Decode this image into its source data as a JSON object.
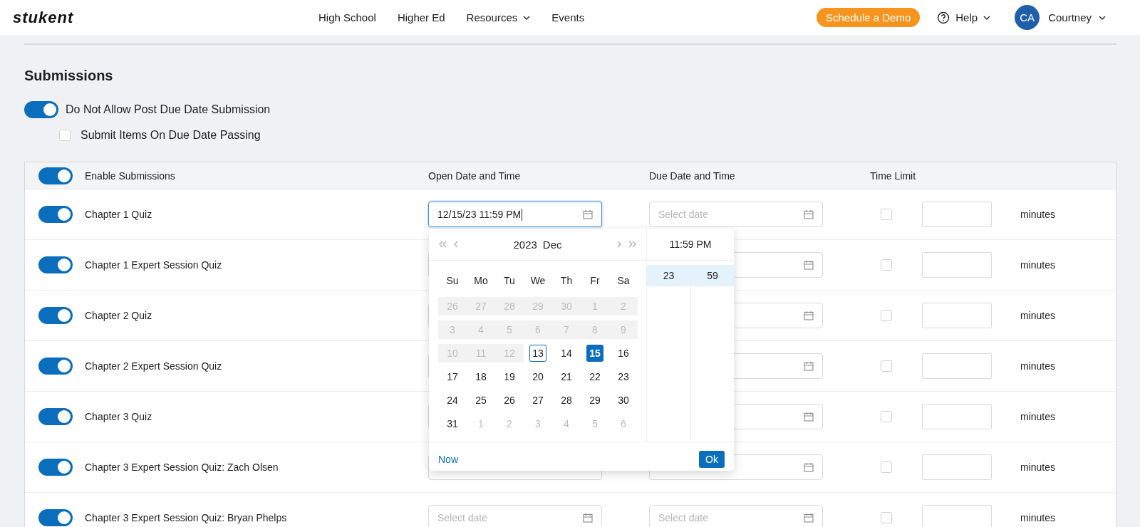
{
  "header": {
    "logo": "stukent",
    "nav": [
      {
        "label": "High School",
        "dropdown": false
      },
      {
        "label": "Higher Ed",
        "dropdown": false
      },
      {
        "label": "Resources",
        "dropdown": true
      },
      {
        "label": "Events",
        "dropdown": false
      }
    ],
    "demo_button": "Schedule a Demo",
    "help": "Help",
    "avatar_initials": "CA",
    "user_name": "Courtney"
  },
  "section_title": "Submissions",
  "options": [
    {
      "kind": "toggle",
      "label": "Do Not Allow Post Due Date Submission",
      "on": true
    },
    {
      "kind": "checkbox",
      "label": "Submit Items On Due Date Passing",
      "checked": false
    }
  ],
  "table": {
    "enable_all": {
      "label": "Enable Submissions",
      "on": true
    },
    "columns": [
      "Open Date and Time",
      "Due Date and Time",
      "Time Limit"
    ],
    "rows": [
      {
        "name": "Chapter 1 Quiz",
        "on": true,
        "open_date": {
          "value": "12/15/23 11:59 PM",
          "focused": true
        },
        "due_date": {
          "placeholder": "Select date"
        },
        "time_limit_checked": false,
        "unit": "minutes"
      },
      {
        "name": "Chapter 1 Expert Session Quiz",
        "on": true,
        "open_date": {},
        "due_date": {},
        "time_limit_checked": false,
        "unit": "minutes"
      },
      {
        "name": "Chapter 2 Quiz",
        "on": true,
        "open_date": {},
        "due_date": {},
        "time_limit_checked": false,
        "unit": "minutes"
      },
      {
        "name": "Chapter 2 Expert Session Quiz",
        "on": true,
        "open_date": {},
        "due_date": {},
        "time_limit_checked": false,
        "unit": "minutes"
      },
      {
        "name": "Chapter 3 Quiz",
        "on": true,
        "open_date": {},
        "due_date": {},
        "time_limit_checked": false,
        "unit": "minutes"
      },
      {
        "name": "Chapter 3 Expert Session Quiz: Zach Olsen",
        "on": true,
        "open_date": {},
        "due_date": {},
        "time_limit_checked": false,
        "unit": "minutes"
      },
      {
        "name": "Chapter 3 Expert Session Quiz: Bryan Phelps",
        "on": true,
        "open_date": {
          "placeholder": "Select date"
        },
        "due_date": {
          "placeholder": "Select date"
        },
        "time_limit_checked": false,
        "unit": "minutes"
      }
    ]
  },
  "date_picker": {
    "year": "2023",
    "month": "Dec",
    "weekdays": [
      "Su",
      "Mo",
      "Tu",
      "We",
      "Th",
      "Fr",
      "Sa"
    ],
    "weeks": [
      [
        {
          "label": "26",
          "disabled": true,
          "selected": false,
          "today": false
        },
        {
          "label": "27",
          "disabled": true,
          "selected": false,
          "today": false
        },
        {
          "label": "28",
          "disabled": true,
          "selected": false,
          "today": false
        },
        {
          "label": "29",
          "disabled": true,
          "selected": false,
          "today": false
        },
        {
          "label": "30",
          "disabled": true,
          "selected": false,
          "today": false
        },
        {
          "label": "1",
          "disabled": true,
          "selected": false,
          "today": false
        },
        {
          "label": "2",
          "disabled": true,
          "selected": false,
          "today": false
        }
      ],
      [
        {
          "label": "3",
          "disabled": true,
          "selected": false,
          "today": false
        },
        {
          "label": "4",
          "disabled": true,
          "selected": false,
          "today": false
        },
        {
          "label": "5",
          "disabled": true,
          "selected": false,
          "today": false
        },
        {
          "label": "6",
          "disabled": true,
          "selected": false,
          "today": false
        },
        {
          "label": "7",
          "disabled": true,
          "selected": false,
          "today": false
        },
        {
          "label": "8",
          "disabled": true,
          "selected": false,
          "today": false
        },
        {
          "label": "9",
          "disabled": true,
          "selected": false,
          "today": false
        }
      ],
      [
        {
          "label": "10",
          "disabled": true,
          "selected": false,
          "today": false
        },
        {
          "label": "11",
          "disabled": true,
          "selected": false,
          "today": false
        },
        {
          "label": "12",
          "disabled": true,
          "selected": false,
          "today": false
        },
        {
          "label": "13",
          "outside": false,
          "disabled": false,
          "selected": false,
          "today": true
        },
        {
          "label": "14",
          "outside": false,
          "disabled": false,
          "selected": false,
          "today": false
        },
        {
          "label": "15",
          "outside": false,
          "disabled": false,
          "selected": true,
          "today": false
        },
        {
          "label": "16",
          "outside": false,
          "disabled": false,
          "selected": false,
          "today": false
        }
      ],
      [
        {
          "label": "17",
          "outside": false,
          "disabled": false,
          "selected": false,
          "today": false
        },
        {
          "label": "18",
          "outside": false,
          "disabled": false,
          "selected": false,
          "today": false
        },
        {
          "label": "19",
          "outside": false,
          "disabled": false,
          "selected": false,
          "today": false
        },
        {
          "label": "20",
          "outside": false,
          "disabled": false,
          "selected": false,
          "today": false
        },
        {
          "label": "21",
          "outside": false,
          "disabled": false,
          "selected": false,
          "today": false
        },
        {
          "label": "22",
          "outside": false,
          "disabled": false,
          "selected": false,
          "today": false
        },
        {
          "label": "23",
          "outside": false,
          "disabled": false,
          "selected": false,
          "today": false
        }
      ],
      [
        {
          "label": "24",
          "outside": false,
          "disabled": false,
          "selected": false,
          "today": false
        },
        {
          "label": "25",
          "outside": false,
          "disabled": false,
          "selected": false,
          "today": false
        },
        {
          "label": "26",
          "outside": false,
          "disabled": false,
          "selected": false,
          "today": false
        },
        {
          "label": "27",
          "outside": false,
          "disabled": false,
          "selected": false,
          "today": false
        },
        {
          "label": "28",
          "outside": false,
          "disabled": false,
          "selected": false,
          "today": false
        },
        {
          "label": "29",
          "outside": false,
          "disabled": false,
          "selected": false,
          "today": false
        },
        {
          "label": "30",
          "outside": false,
          "disabled": false,
          "selected": false,
          "today": false
        }
      ],
      [
        {
          "label": "31",
          "outside": false,
          "disabled": false,
          "selected": false,
          "today": false
        },
        {
          "label": "1",
          "outside": true,
          "disabled": false,
          "selected": false,
          "today": false
        },
        {
          "label": "2",
          "outside": true,
          "disabled": false,
          "selected": false,
          "today": false
        },
        {
          "label": "3",
          "outside": true,
          "disabled": false,
          "selected": false,
          "today": false
        },
        {
          "label": "4",
          "outside": true,
          "disabled": false,
          "selected": false,
          "today": false
        },
        {
          "label": "5",
          "outside": true,
          "disabled": false,
          "selected": false,
          "today": false
        },
        {
          "label": "6",
          "outside": true,
          "disabled": false,
          "selected": false,
          "today": false
        }
      ]
    ],
    "time_title": "11:59 PM",
    "hours": [
      {
        "label": "23",
        "selected": true
      }
    ],
    "minutes": [
      {
        "label": "59",
        "selected": true
      }
    ],
    "now_link": "Now",
    "ok_button": "Ok"
  }
}
